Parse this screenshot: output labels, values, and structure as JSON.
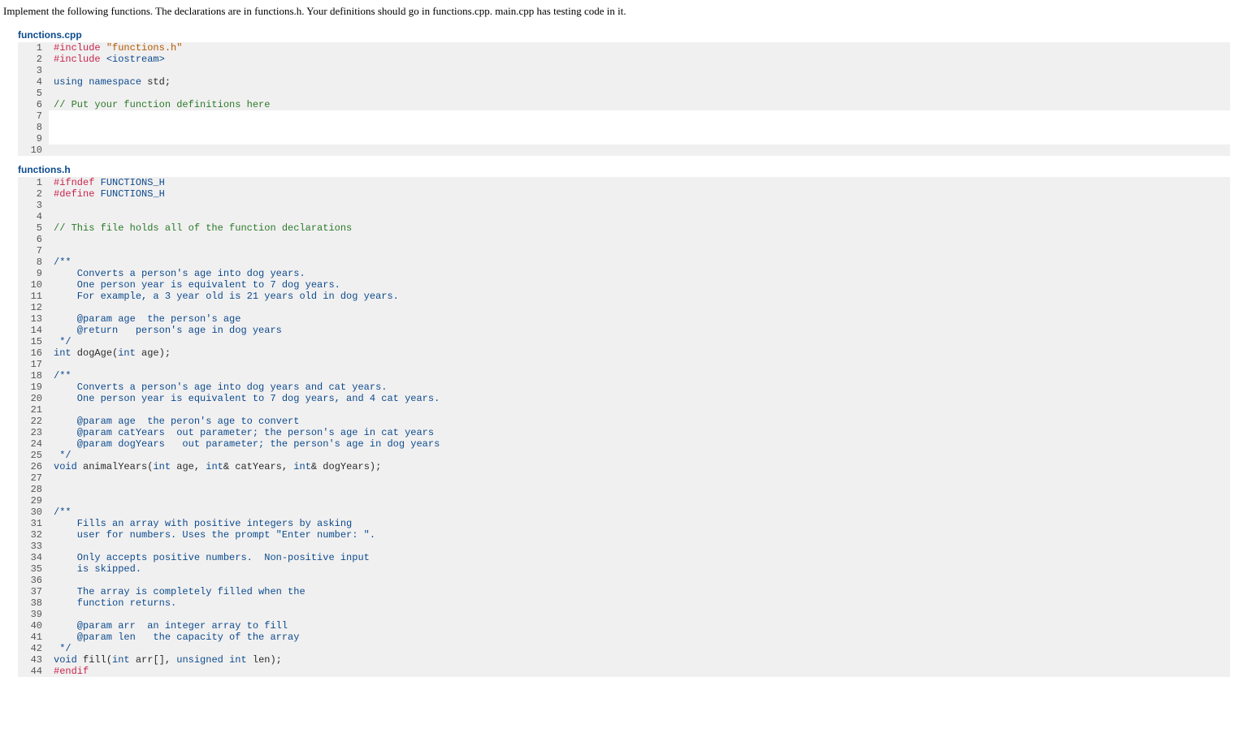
{
  "instructions": "Implement the following functions. The declarations are in functions.h. Your definitions should go in functions.cpp. main.cpp has testing code in it.",
  "files": [
    {
      "name": "functions.cpp",
      "lines": [
        {
          "n": 1,
          "tokens": [
            {
              "cls": "tok-preproc",
              "t": "#include"
            },
            {
              "cls": "tok-plain",
              "t": " "
            },
            {
              "cls": "tok-string",
              "t": "\"functions.h\""
            }
          ]
        },
        {
          "n": 2,
          "tokens": [
            {
              "cls": "tok-preproc",
              "t": "#include"
            },
            {
              "cls": "tok-plain",
              "t": " "
            },
            {
              "cls": "tok-include-sys",
              "t": "<iostream>"
            }
          ]
        },
        {
          "n": 3,
          "tokens": []
        },
        {
          "n": 4,
          "tokens": [
            {
              "cls": "tok-keyword",
              "t": "using"
            },
            {
              "cls": "tok-plain",
              "t": " "
            },
            {
              "cls": "tok-keyword",
              "t": "namespace"
            },
            {
              "cls": "tok-plain",
              "t": " std;"
            }
          ]
        },
        {
          "n": 5,
          "tokens": []
        },
        {
          "n": 6,
          "tokens": [
            {
              "cls": "tok-comment",
              "t": "// Put your function definitions here"
            }
          ]
        },
        {
          "n": 7,
          "active": true,
          "tokens": []
        },
        {
          "n": 8,
          "active": true,
          "tokens": []
        },
        {
          "n": 9,
          "active": true,
          "tokens": []
        },
        {
          "n": 10,
          "tokens": []
        }
      ]
    },
    {
      "name": "functions.h",
      "lines": [
        {
          "n": 1,
          "tokens": [
            {
              "cls": "tok-preproc",
              "t": "#ifndef"
            },
            {
              "cls": "tok-plain",
              "t": " "
            },
            {
              "cls": "tok-include-sys",
              "t": "FUNCTIONS_H"
            }
          ]
        },
        {
          "n": 2,
          "tokens": [
            {
              "cls": "tok-preproc",
              "t": "#define"
            },
            {
              "cls": "tok-plain",
              "t": " "
            },
            {
              "cls": "tok-include-sys",
              "t": "FUNCTIONS_H"
            }
          ]
        },
        {
          "n": 3,
          "tokens": []
        },
        {
          "n": 4,
          "tokens": []
        },
        {
          "n": 5,
          "tokens": [
            {
              "cls": "tok-comment",
              "t": "// This file holds all of the function declarations"
            }
          ]
        },
        {
          "n": 6,
          "tokens": []
        },
        {
          "n": 7,
          "tokens": []
        },
        {
          "n": 8,
          "tokens": [
            {
              "cls": "tok-doccmt",
              "t": "/**"
            }
          ]
        },
        {
          "n": 9,
          "tokens": [
            {
              "cls": "tok-doccmt",
              "t": "    Converts a person's age into dog years."
            }
          ]
        },
        {
          "n": 10,
          "tokens": [
            {
              "cls": "tok-doccmt",
              "t": "    One person year is equivalent to 7 dog years."
            }
          ]
        },
        {
          "n": 11,
          "tokens": [
            {
              "cls": "tok-doccmt",
              "t": "    For example, a 3 year old is 21 years old in dog years."
            }
          ]
        },
        {
          "n": 12,
          "tokens": []
        },
        {
          "n": 13,
          "tokens": [
            {
              "cls": "tok-doccmt",
              "t": "    @param "
            },
            {
              "cls": "tok-doccmt",
              "t": "age"
            },
            {
              "cls": "tok-doccmt",
              "t": "  the person's age"
            }
          ]
        },
        {
          "n": 14,
          "tokens": [
            {
              "cls": "tok-doccmt",
              "t": "    @return   "
            },
            {
              "cls": "tok-doccmt",
              "t": "person's age in dog years"
            }
          ]
        },
        {
          "n": 15,
          "tokens": [
            {
              "cls": "tok-doccmt",
              "t": " */"
            }
          ]
        },
        {
          "n": 16,
          "tokens": [
            {
              "cls": "tok-keyword",
              "t": "int"
            },
            {
              "cls": "tok-plain",
              "t": " dogAge("
            },
            {
              "cls": "tok-keyword",
              "t": "int"
            },
            {
              "cls": "tok-plain",
              "t": " age);"
            }
          ]
        },
        {
          "n": 17,
          "tokens": []
        },
        {
          "n": 18,
          "tokens": [
            {
              "cls": "tok-doccmt",
              "t": "/**"
            }
          ]
        },
        {
          "n": 19,
          "tokens": [
            {
              "cls": "tok-doccmt",
              "t": "    Converts a person's age into dog years and cat years."
            }
          ]
        },
        {
          "n": 20,
          "tokens": [
            {
              "cls": "tok-doccmt",
              "t": "    One person year is equivalent to 7 dog years, and 4 cat years."
            }
          ]
        },
        {
          "n": 21,
          "tokens": []
        },
        {
          "n": 22,
          "tokens": [
            {
              "cls": "tok-doccmt",
              "t": "    @param "
            },
            {
              "cls": "tok-doccmt",
              "t": "age"
            },
            {
              "cls": "tok-doccmt",
              "t": "  the peron's age to convert"
            }
          ]
        },
        {
          "n": 23,
          "tokens": [
            {
              "cls": "tok-doccmt",
              "t": "    @param "
            },
            {
              "cls": "tok-doccmt",
              "t": "catYears"
            },
            {
              "cls": "tok-doccmt",
              "t": "  out parameter; the person's age in cat years"
            }
          ]
        },
        {
          "n": 24,
          "tokens": [
            {
              "cls": "tok-doccmt",
              "t": "    @param "
            },
            {
              "cls": "tok-doccmt",
              "t": "dogYears"
            },
            {
              "cls": "tok-doccmt",
              "t": "   out parameter; the person's age in dog years"
            }
          ]
        },
        {
          "n": 25,
          "tokens": [
            {
              "cls": "tok-doccmt",
              "t": " */"
            }
          ]
        },
        {
          "n": 26,
          "tokens": [
            {
              "cls": "tok-keyword",
              "t": "void"
            },
            {
              "cls": "tok-plain",
              "t": " animalYears("
            },
            {
              "cls": "tok-keyword",
              "t": "int"
            },
            {
              "cls": "tok-plain",
              "t": " age, "
            },
            {
              "cls": "tok-keyword",
              "t": "int"
            },
            {
              "cls": "tok-plain",
              "t": "& catYears, "
            },
            {
              "cls": "tok-keyword",
              "t": "int"
            },
            {
              "cls": "tok-plain",
              "t": "& dogYears);"
            }
          ]
        },
        {
          "n": 27,
          "tokens": []
        },
        {
          "n": 28,
          "tokens": []
        },
        {
          "n": 29,
          "tokens": []
        },
        {
          "n": 30,
          "tokens": [
            {
              "cls": "tok-doccmt",
              "t": "/**"
            }
          ]
        },
        {
          "n": 31,
          "tokens": [
            {
              "cls": "tok-doccmt",
              "t": "    Fills an array with positive integers by asking"
            }
          ]
        },
        {
          "n": 32,
          "tokens": [
            {
              "cls": "tok-doccmt",
              "t": "    user for numbers. Uses the prompt \"Enter number: \"."
            }
          ]
        },
        {
          "n": 33,
          "tokens": []
        },
        {
          "n": 34,
          "tokens": [
            {
              "cls": "tok-doccmt",
              "t": "    Only accepts positive numbers.  Non-positive input"
            }
          ]
        },
        {
          "n": 35,
          "tokens": [
            {
              "cls": "tok-doccmt",
              "t": "    is skipped."
            }
          ]
        },
        {
          "n": 36,
          "tokens": []
        },
        {
          "n": 37,
          "tokens": [
            {
              "cls": "tok-doccmt",
              "t": "    The array is completely filled when the"
            }
          ]
        },
        {
          "n": 38,
          "tokens": [
            {
              "cls": "tok-doccmt",
              "t": "    function returns."
            }
          ]
        },
        {
          "n": 39,
          "tokens": []
        },
        {
          "n": 40,
          "tokens": [
            {
              "cls": "tok-doccmt",
              "t": "    @param "
            },
            {
              "cls": "tok-doccmt",
              "t": "arr"
            },
            {
              "cls": "tok-doccmt",
              "t": "  an integer array to fill"
            }
          ]
        },
        {
          "n": 41,
          "tokens": [
            {
              "cls": "tok-doccmt",
              "t": "    @param "
            },
            {
              "cls": "tok-doccmt",
              "t": "len"
            },
            {
              "cls": "tok-doccmt",
              "t": "   the capacity of the array"
            }
          ]
        },
        {
          "n": 42,
          "tokens": [
            {
              "cls": "tok-doccmt",
              "t": " */"
            }
          ]
        },
        {
          "n": 43,
          "tokens": [
            {
              "cls": "tok-keyword",
              "t": "void"
            },
            {
              "cls": "tok-plain",
              "t": " fill("
            },
            {
              "cls": "tok-keyword",
              "t": "int"
            },
            {
              "cls": "tok-plain",
              "t": " arr[], "
            },
            {
              "cls": "tok-keyword",
              "t": "unsigned"
            },
            {
              "cls": "tok-plain",
              "t": " "
            },
            {
              "cls": "tok-keyword",
              "t": "int"
            },
            {
              "cls": "tok-plain",
              "t": " len);"
            }
          ]
        },
        {
          "n": 44,
          "tokens": [
            {
              "cls": "tok-preproc",
              "t": "#endif"
            }
          ]
        }
      ]
    }
  ]
}
